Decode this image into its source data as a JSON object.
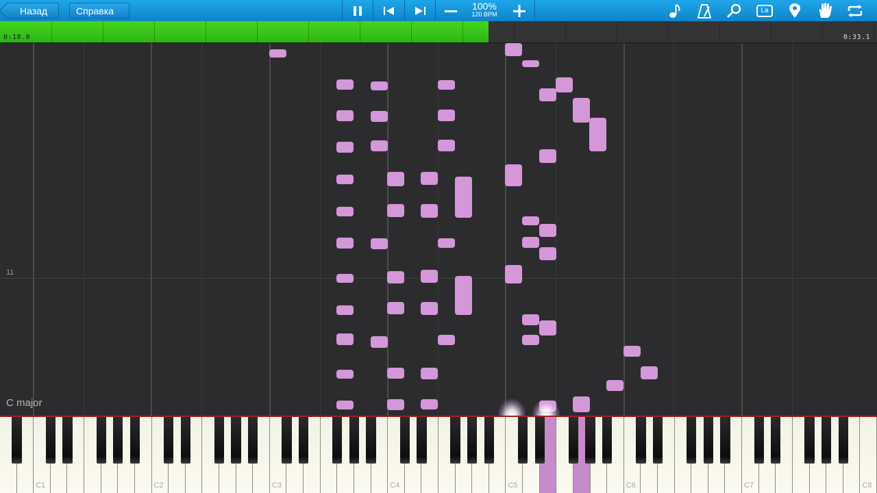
{
  "toolbar": {
    "back_label": "Назад",
    "help_label": "Справка",
    "speed_percent": "100%",
    "tempo": "120 BPM",
    "icons": [
      "pause-icon",
      "skip-back-icon",
      "skip-forward-icon",
      "minus-icon",
      "plus-icon",
      "note-icon",
      "metronome-icon",
      "magnifier-icon",
      "la-icon",
      "location-icon",
      "hand-icon",
      "loop-icon"
    ],
    "la_text": "La"
  },
  "progress": {
    "current_time": "0:18.0",
    "total_time": "0:33.1",
    "fraction": 0.557,
    "color": "#2db514"
  },
  "roll": {
    "measure_number": "11",
    "key_signature": "C major",
    "note_color": "#d497d9"
  },
  "keyboard": {
    "octave_labels": [
      "C1",
      "C2",
      "C3",
      "C4",
      "C5",
      "C6",
      "C7",
      "C8"
    ],
    "active_color": "#c78acb"
  }
}
